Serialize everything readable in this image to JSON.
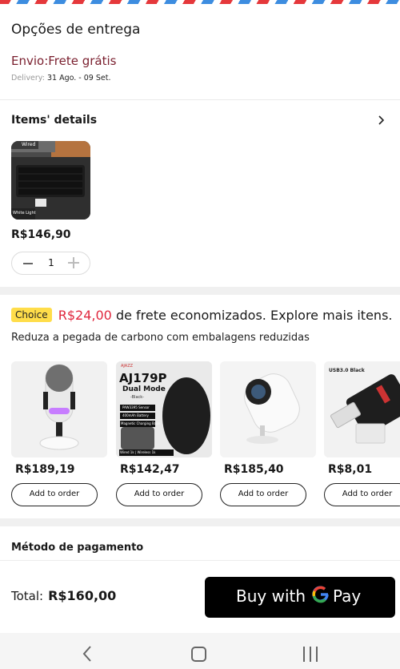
{
  "delivery": {
    "title": "Opções de entrega",
    "shipping": "Envio:Frete grátis",
    "delivery_label": "Delivery:",
    "delivery_dates": "31 Ago. - 09 Set."
  },
  "items": {
    "title": "Items' details",
    "product": {
      "badge_top": "Wired",
      "badge_bottom": "White Light",
      "price": "R$146,90",
      "quantity": "1"
    }
  },
  "promo": {
    "badge": "Choice",
    "saved_amount": "R$24,00",
    "saved_text": "de frete economizados. Explore mais itens.",
    "subtitle": "Reduza a pegada de carbono com embalagens reduzidas"
  },
  "recommendations": [
    {
      "price": "R$189,19",
      "button": "Add to order"
    },
    {
      "price": "R$142,47",
      "button": "Add to order",
      "img_title": "AJ179P",
      "img_subtitle": "Dual Mode",
      "img_variant": "-Black-",
      "img_brand": "AJAZZ",
      "img_spec1": "PAW3395 Sensor",
      "img_spec2": "400mAh Battery",
      "img_spec3": "Magnetic Charging Base",
      "img_footer": "Wired 1k | Wireless 1k"
    },
    {
      "price": "R$185,40",
      "button": "Add to order"
    },
    {
      "price": "R$8,01",
      "button": "Add to order",
      "img_title": "USB3.0 Black"
    }
  ],
  "payment": {
    "title": "Método de pagamento"
  },
  "footer": {
    "total_label": "Total:",
    "total_value": "R$160,00",
    "buy_with": "Buy with",
    "pay": "Pay"
  },
  "colors": {
    "accent_red": "#e0273d",
    "shipping_text": "#7a1f2e",
    "choice_badge": "#ffdd4a",
    "gpay_button": "#000000"
  }
}
